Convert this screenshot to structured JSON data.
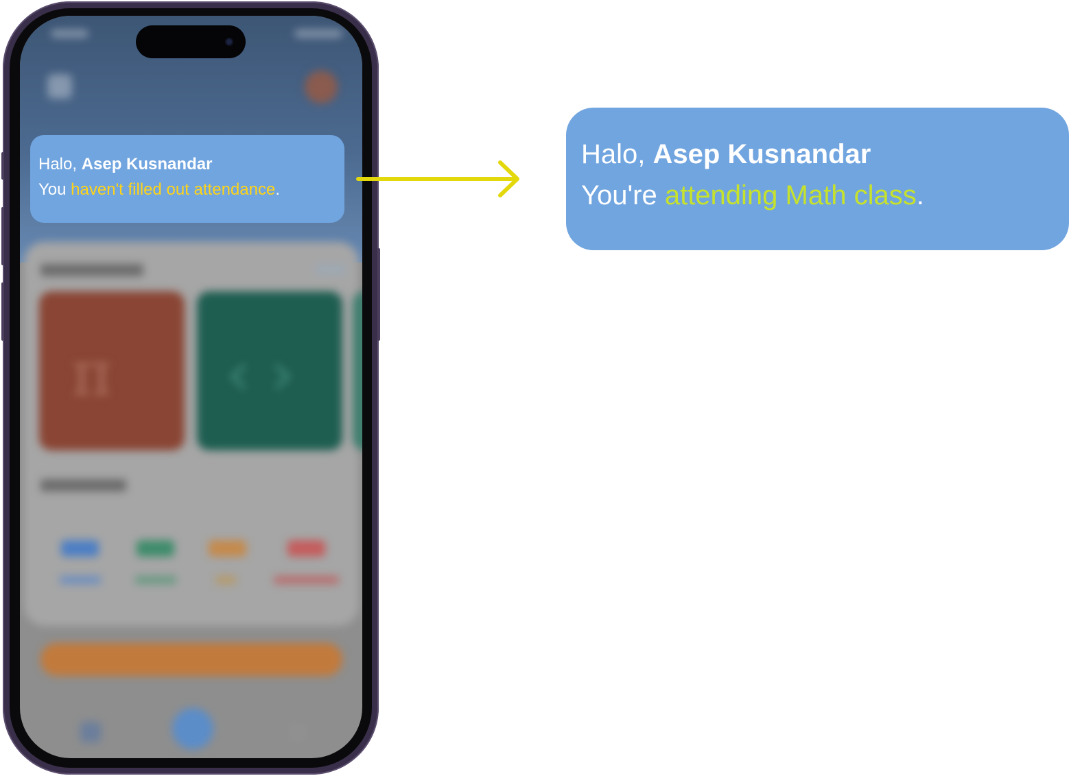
{
  "colors": {
    "card_bg": "#71a5df",
    "highlight_warning": "#ffd417",
    "highlight_success": "#c6e22c",
    "arrow": "#e3d80c",
    "phone_frame": "#3a2f4a"
  },
  "phone_notification": {
    "greeting": "Halo, ",
    "user_name": "Asep Kusnandar",
    "message_prefix": "You ",
    "message_highlight": "haven't filled out attendance",
    "message_suffix": "."
  },
  "result_notification": {
    "greeting": "Halo, ",
    "user_name": "Asep Kusnandar",
    "message_prefix": "You're ",
    "message_highlight": "attending Math class",
    "message_suffix": "."
  },
  "icons": {
    "arrow": "arrow-right-icon",
    "tile_math": "pi-icon",
    "tile_code": "code-brackets-icon"
  }
}
